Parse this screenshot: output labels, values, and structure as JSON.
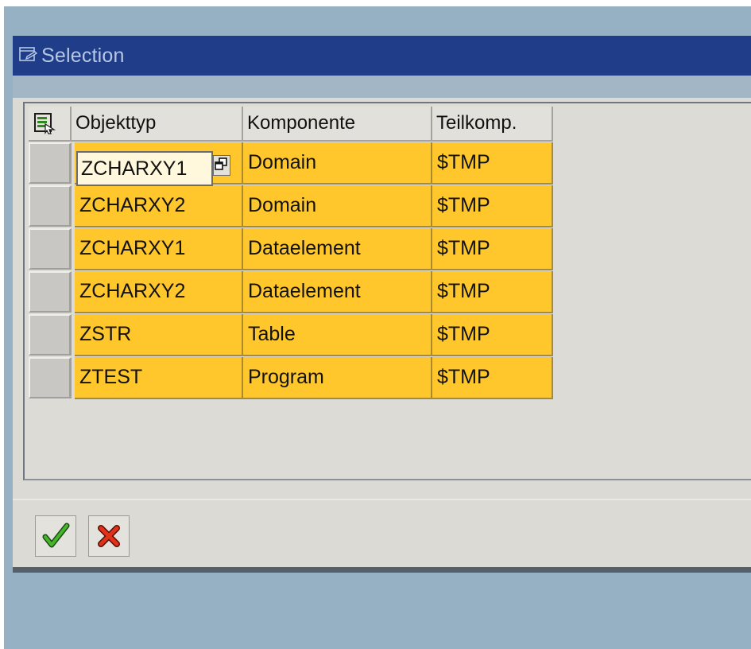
{
  "dialog": {
    "title": "Selection"
  },
  "table": {
    "columns": [
      "Objekttyp",
      "Komponente",
      "Teilkomp."
    ],
    "rows": [
      [
        "ZCHARXY1",
        "Domain",
        "$TMP"
      ],
      [
        "ZCHARXY2",
        "Domain",
        "$TMP"
      ],
      [
        "ZCHARXY1",
        "Dataelement",
        "$TMP"
      ],
      [
        "ZCHARXY2",
        "Dataelement",
        "$TMP"
      ],
      [
        "ZSTR",
        "Table",
        "$TMP"
      ],
      [
        "ZTEST",
        "Program",
        "$TMP"
      ]
    ],
    "focused_cell_row": 0,
    "focused_cell_column": 0
  },
  "icons": {
    "title": "dialog-window-icon",
    "layout": "table-layout-icon",
    "value_help": "value-help-icon",
    "confirm": "checkmark-icon",
    "cancel": "cancel-x-icon"
  },
  "colors": {
    "title_bar": "#1f3d88",
    "row_highlight": "#ffc72c",
    "confirm_green": "#2e8b1f",
    "cancel_red": "#d22a12"
  }
}
